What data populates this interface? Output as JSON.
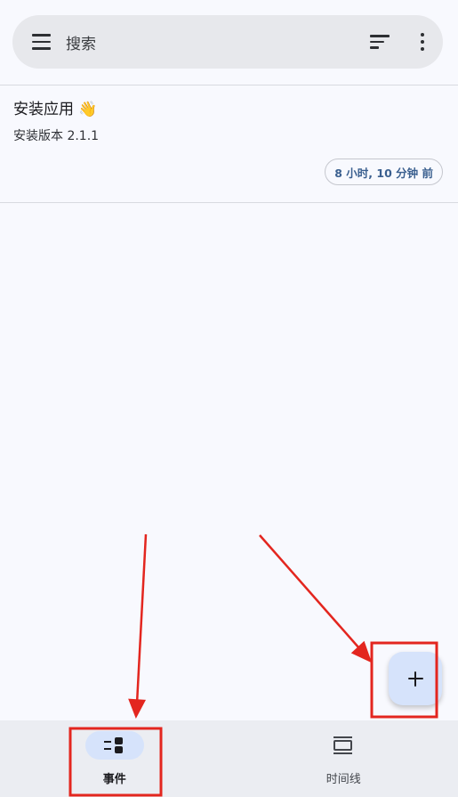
{
  "search": {
    "placeholder": "搜索"
  },
  "event": {
    "title": "安装应用 👋",
    "subtitle": "安装版本 2.1.1",
    "time_chip": "8 小时, 10 分钟 前"
  },
  "fab": {
    "icon": "plus-icon"
  },
  "bottom_nav": {
    "items": [
      {
        "label": "事件",
        "icon": "events-icon",
        "active": true
      },
      {
        "label": "时间线",
        "icon": "timeline-icon",
        "active": false
      }
    ]
  },
  "colors": {
    "background": "#f8f9fe",
    "search_bar": "#e7e8ec",
    "accent_container": "#d6e3fb",
    "chip_text": "#3a5f8f",
    "annotation": "#e3261f"
  }
}
